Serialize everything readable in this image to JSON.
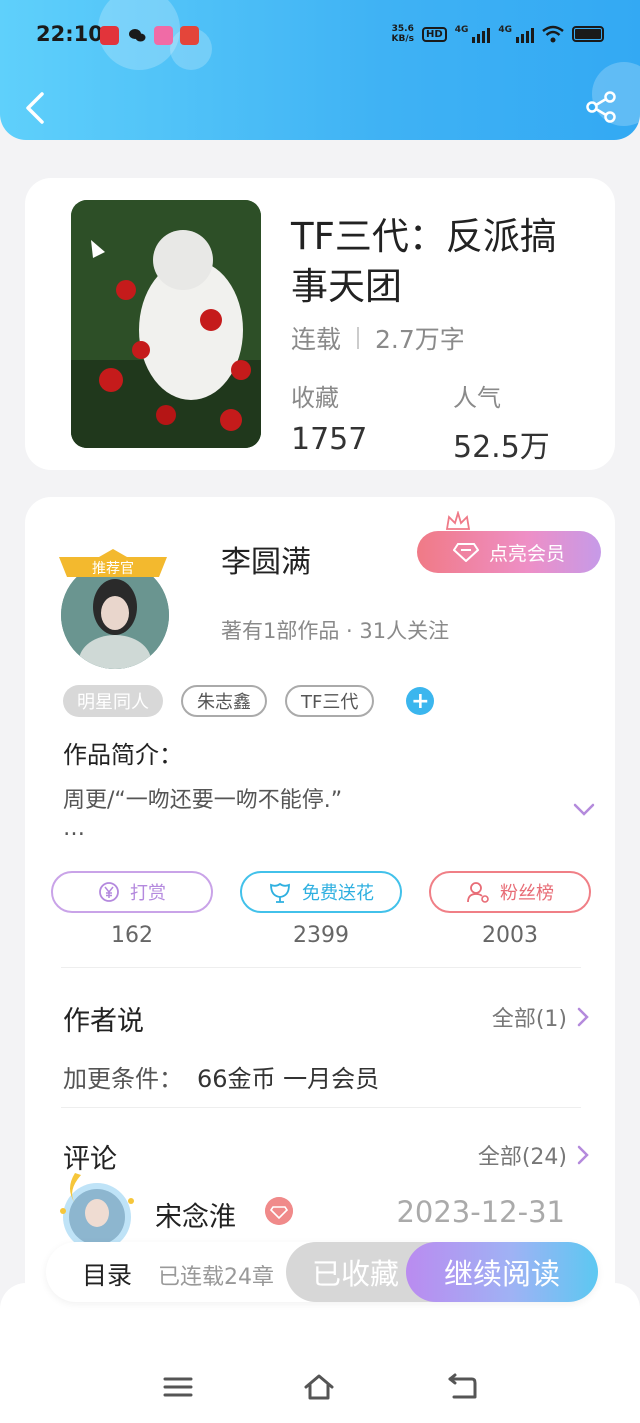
{
  "statusbar": {
    "time": "22:10",
    "net_speed_value": "35.6",
    "net_speed_unit": "KB/s",
    "hd_label": "HD",
    "signal1_label": "4G",
    "signal2_label": "4G"
  },
  "header": {
    "back": "back-icon",
    "share": "share-icon"
  },
  "book": {
    "title": "TF三代：反派搞事天团",
    "status": "连载",
    "word_count": "2.7万字",
    "favorites_label": "收藏",
    "favorites_value": "1757",
    "popularity_label": "人气",
    "popularity_value": "52.5万"
  },
  "author": {
    "badge": "推荐官",
    "name": "李圆满",
    "vip_button": "点亮会员",
    "stats": "著有1部作品 · 31人关注"
  },
  "tags": [
    "明星同人",
    "朱志鑫",
    "TF三代"
  ],
  "intro": {
    "heading": "作品简介：",
    "text": "周更/“一吻还要一吻不能停.”",
    "ellipsis": "…"
  },
  "actions": [
    {
      "label": "打赏",
      "count": "162",
      "icon": "yen-icon"
    },
    {
      "label": "免费送花",
      "count": "2399",
      "icon": "flower-icon"
    },
    {
      "label": "粉丝榜",
      "count": "2003",
      "icon": "fans-icon"
    }
  ],
  "author_says": {
    "title": "作者说",
    "more": "全部(1)",
    "condition_label": "加更条件：",
    "condition_value": "66金币 一月会员"
  },
  "comments": {
    "title": "评论",
    "more": "全部(24)",
    "first_name": "宋念淮",
    "first_date": "2023-12-31"
  },
  "bottom_bar": {
    "toc": "目录",
    "serial": "已连载24章",
    "favorited": "已收藏",
    "continue": "继续阅读"
  },
  "colors": {
    "header": "#3fb2f4",
    "accent_blue": "#42c1ea",
    "accent_purple": "#b489de",
    "accent_red": "#e86c76"
  }
}
